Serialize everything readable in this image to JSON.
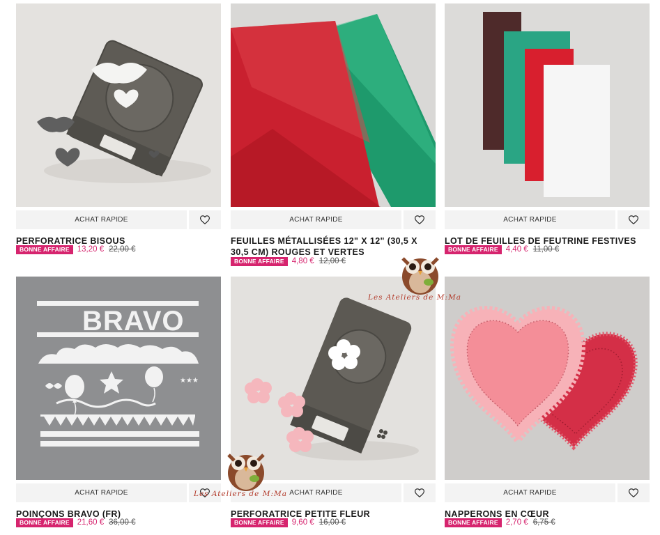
{
  "quick_label": "ACHAT RAPIDE",
  "products": [
    {
      "title": "PERFORATRICE BISOUS",
      "badge": "BONNE AFFAIRE",
      "price": "13,20 €",
      "old_price": "22,00 €"
    },
    {
      "title": "FEUILLES MÉTALLISÉES 12\" X 12\" (30,5 X 30,5 CM) ROUGES ET VERTES",
      "badge": "BONNE AFFAIRE",
      "price": "4,80 €",
      "old_price": "12,00 €"
    },
    {
      "title": "LOT DE FEUILLES DE FEUTRINE FESTIVES",
      "badge": "BONNE AFFAIRE",
      "price": "4,40 €",
      "old_price": "11,00 €"
    },
    {
      "title": "POINÇONS BRAVO (FR)",
      "badge": "BONNE AFFAIRE",
      "price": "21,60 €",
      "old_price": "36,00 €"
    },
    {
      "title": "PERFORATRICE PETITE FLEUR",
      "badge": "BONNE AFFAIRE",
      "price": "9,60 €",
      "old_price": "16,00 €"
    },
    {
      "title": "NAPPERONS EN CŒUR",
      "badge": "BONNE AFFAIRE",
      "price": "2,70 €",
      "old_price": "6,75 €"
    }
  ],
  "watermark": {
    "text": "Les Ateliers de M:Ma"
  },
  "colors": {
    "accent": "#d6246e",
    "button_bg": "#f3f3f3"
  },
  "icons": {
    "wishlist": "heart-outline-icon"
  }
}
